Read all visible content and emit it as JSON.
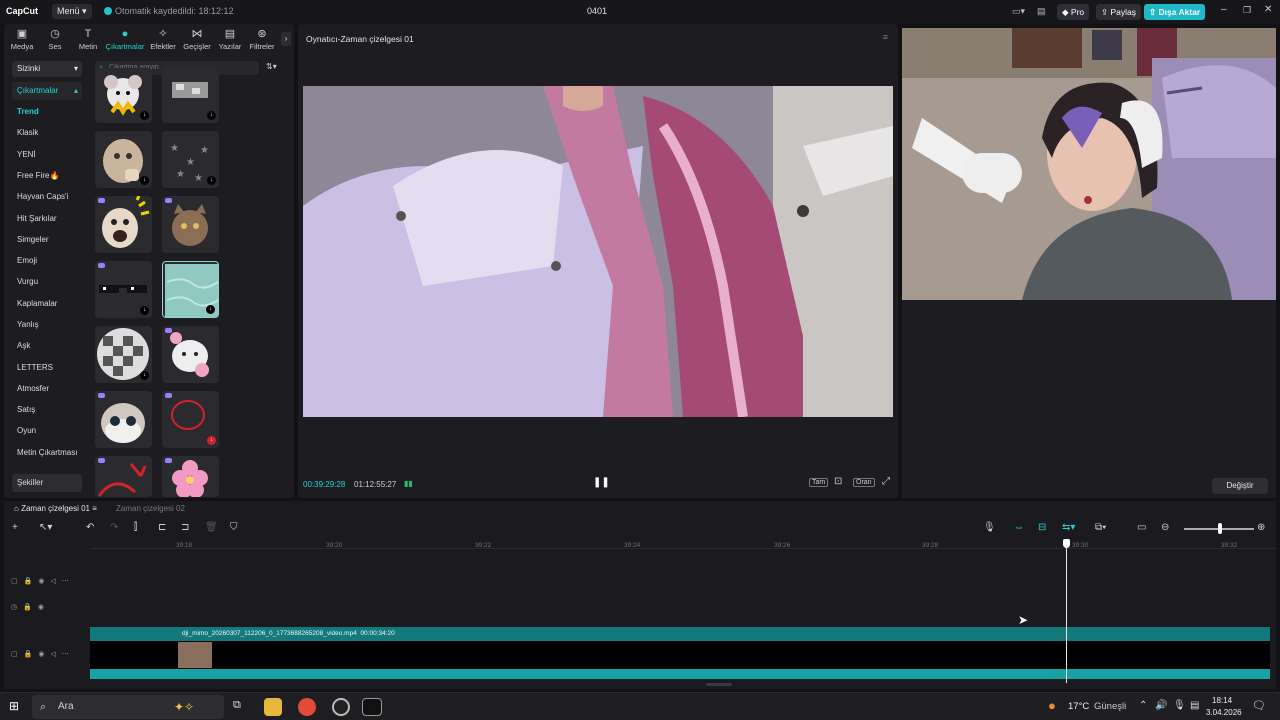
{
  "app": {
    "logo": "CapCut",
    "menu": "Menü",
    "autosave": "Otomatik kaydedildi: 18:12:12",
    "project_title": "0401",
    "pro_label": "Pro",
    "share_label": "Paylaş",
    "export_label": "Dışa Aktar"
  },
  "left_tabs": [
    {
      "label": "Medya",
      "icon": "media-icon"
    },
    {
      "label": "Ses",
      "icon": "audio-icon"
    },
    {
      "label": "Metin",
      "icon": "text-icon"
    },
    {
      "label": "Çıkartmalar",
      "icon": "sticker-icon"
    },
    {
      "label": "Efektler",
      "icon": "effects-icon"
    },
    {
      "label": "Geçişler",
      "icon": "transitions-icon"
    },
    {
      "label": "Yazılar",
      "icon": "captions-icon"
    },
    {
      "label": "Filtreler",
      "icon": "filters-icon"
    }
  ],
  "sidebar": {
    "for_you": "Sizinki",
    "stickers_header": "Çıkartmalar",
    "categories": [
      "Trend",
      "Klasik",
      "YENİ",
      "Free Fire🔥",
      "Hayvan Caps'i",
      "Hit Şarkılar",
      "Simgeler",
      "Emoji",
      "Vurgu",
      "Kaplamalar",
      "Yanlış",
      "Aşk",
      "LETTERS",
      "Atmosfer",
      "Satış",
      "Oyun",
      "Metin Çıkartması"
    ],
    "shapes": "Şekiller"
  },
  "search": {
    "placeholder": "Çıkartma arayın"
  },
  "player": {
    "title": "Oynatıcı-Zaman çizelgesi 01",
    "current_time": "00:39:29:28",
    "total_time": "01:12:55:27",
    "full_label": "Tam",
    "ratio_label": "Oran"
  },
  "right_panel": {
    "change_label": "Değiştir"
  },
  "timeline": {
    "tabs": [
      "Zaman çizelgesi 01",
      "Zaman çizelgesi 02"
    ],
    "ruler": [
      "39:18",
      "39:20",
      "39:22",
      "39:24",
      "39:26",
      "39:28",
      "39:30",
      "39:32"
    ],
    "clip_name": "dji_mimo_20260307_112206_0_1773688265208_video.mp4",
    "clip_duration": "00:00:34:20"
  },
  "taskbar": {
    "search": "Ara",
    "weather": "17°C",
    "weather_text": "Güneşli",
    "time": "18:14",
    "date": "3.04.2026"
  },
  "colors": {
    "accent": "#22d3d3",
    "bg": "#121214",
    "panel": "#1d1d21",
    "clip": "#14797a"
  }
}
